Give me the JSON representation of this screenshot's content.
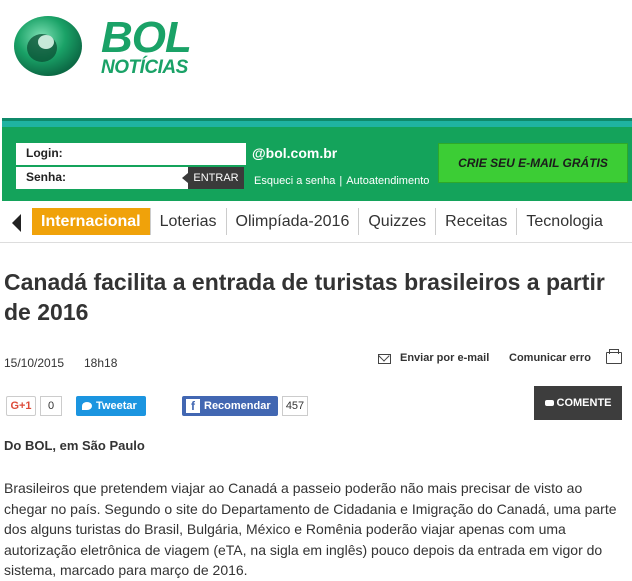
{
  "brand": {
    "name": "BOL",
    "section": "NOTÍCIAS"
  },
  "login": {
    "login_label": "Login:",
    "login_value": "",
    "senha_label": "Senha:",
    "senha_value": "",
    "entrar_label": "ENTRAR",
    "domain": "@bol.com.br",
    "forgot_label": "Esqueci a senha",
    "separator": "|",
    "self_service_label": "Autoatendimento",
    "create_email_label": "CRIE SEU E-MAIL GRÁTIS"
  },
  "nav": {
    "items": [
      {
        "label": "Internacional"
      },
      {
        "label": "Loterias"
      },
      {
        "label": "Olimpíada-2016"
      },
      {
        "label": "Quizzes"
      },
      {
        "label": "Receitas"
      },
      {
        "label": "Tecnologia"
      }
    ],
    "active_index": 0
  },
  "article": {
    "headline": "Canadá facilita a entrada de turistas brasileiros a partir de 2016",
    "date": "15/10/2015",
    "time": "18h18",
    "send_email_label": "Enviar por e-mail",
    "report_error_label": "Comunicar erro",
    "byline": "Do BOL, em São Paulo",
    "body": "Brasileiros que pretendem viajar ao Canadá a passeio poderão não mais precisar de visto ao chegar no país. Segundo o site do Departamento de Cidadania e Imigração do Canadá, uma parte dos alguns turistas do Brasil, Bulgária, México e Romênia poderão viajar apenas com uma autorização eletrônica de viagem (eTA, na sigla em inglês) pouco depois da entrada em vigor do sistema, marcado para março de 2016."
  },
  "social": {
    "gplus_label": "G+1",
    "gplus_count": "0",
    "tweet_label": "Tweetar",
    "fb_label": "Recomendar",
    "fb_count": "457",
    "comment_label": "COMENTE"
  },
  "colors": {
    "brand_green": "#1aa267",
    "bar_green": "#14a35b",
    "nav_active": "#f0a20a",
    "twitter": "#1b95e0",
    "facebook": "#4267b2"
  }
}
